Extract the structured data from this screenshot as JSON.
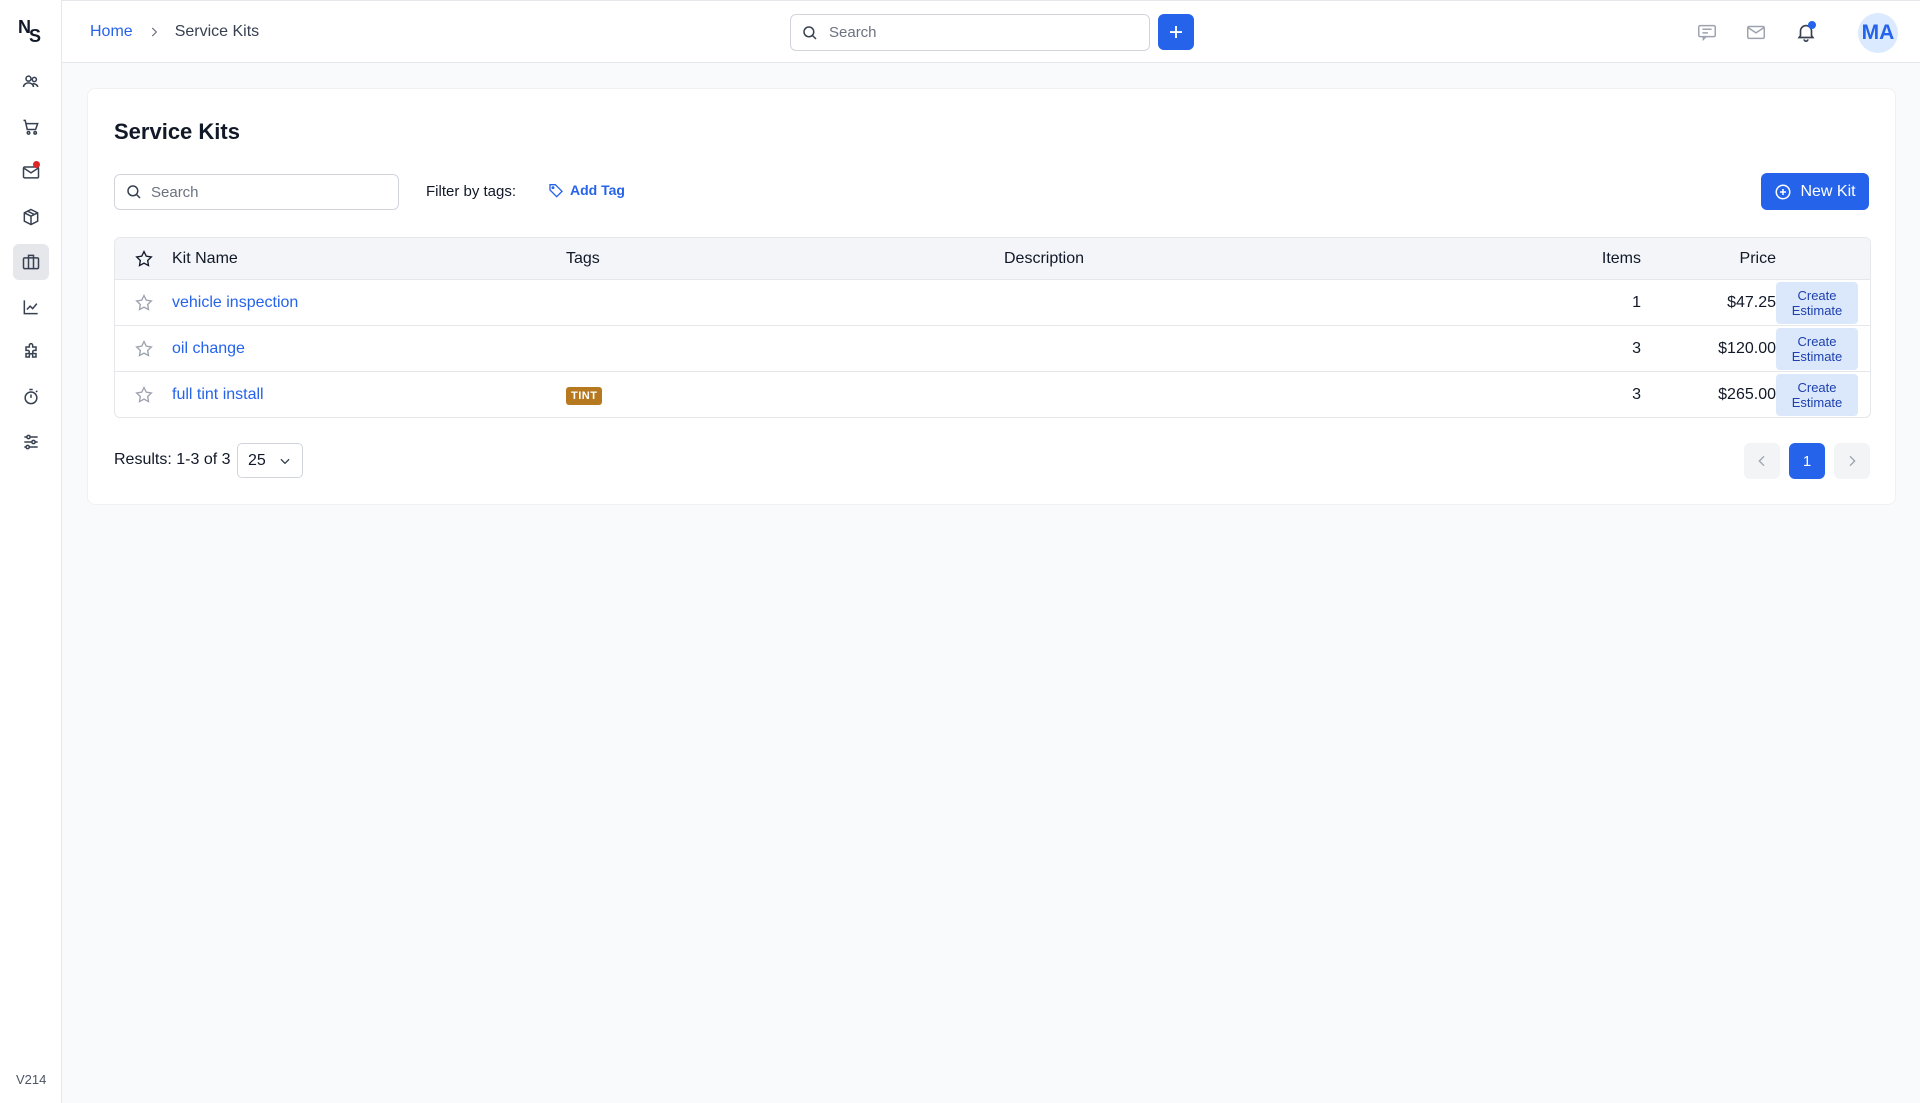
{
  "app": {
    "version": "V214",
    "logo_text": "NS"
  },
  "sidebar": {
    "items": [
      {
        "name": "customers",
        "icon": "people-icon"
      },
      {
        "name": "orders",
        "icon": "cart-icon"
      },
      {
        "name": "messages",
        "icon": "mail-icon",
        "badge": true
      },
      {
        "name": "inventory",
        "icon": "box-icon"
      },
      {
        "name": "service-kits",
        "icon": "briefcase-icon",
        "active": true
      },
      {
        "name": "reports",
        "icon": "chart-icon"
      },
      {
        "name": "integrations",
        "icon": "puzzle-icon"
      },
      {
        "name": "time-clock",
        "icon": "stopwatch-icon"
      },
      {
        "name": "settings",
        "icon": "sliders-icon"
      }
    ]
  },
  "topbar": {
    "breadcrumb": {
      "home": "Home",
      "current": "Service Kits"
    },
    "search_placeholder": "Search",
    "avatar_initials": "MA"
  },
  "main": {
    "title": "Service Kits",
    "search_placeholder": "Search",
    "filter_label": "Filter by tags:",
    "add_tag_label": "Add Tag",
    "new_kit_label": "New Kit",
    "columns": {
      "name": "Kit Name",
      "tags": "Tags",
      "description": "Description",
      "items": "Items",
      "price": "Price"
    },
    "rows": [
      {
        "name": "vehicle inspection",
        "tag": "",
        "description": "",
        "items": "1",
        "price": "$47.25",
        "action": "Create Estimate"
      },
      {
        "name": "oil change",
        "tag": "",
        "description": "",
        "items": "3",
        "price": "$120.00",
        "action": "Create Estimate"
      },
      {
        "name": "full tint install",
        "tag": "TINT",
        "description": "",
        "items": "3",
        "price": "$265.00",
        "action": "Create Estimate"
      }
    ],
    "results_text": "Results: 1-3 of 3",
    "per_page": "25",
    "current_page": "1"
  },
  "colors": {
    "accent": "#2563eb",
    "tag_tint": "#b7791f",
    "badge_red": "#dc2626"
  }
}
